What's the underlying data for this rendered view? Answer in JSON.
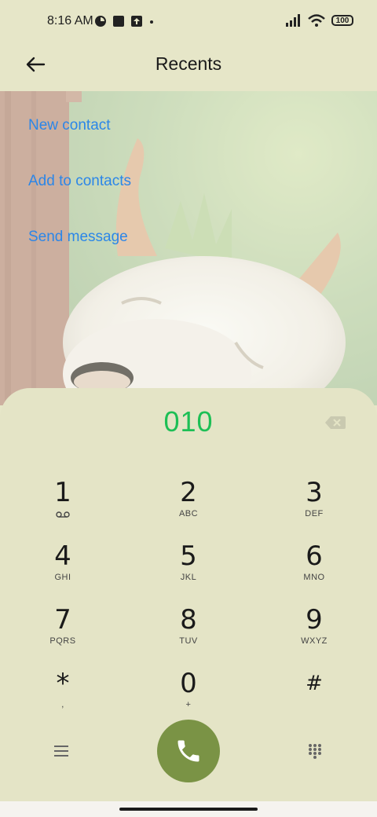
{
  "status_bar": {
    "time": "8:16 AM",
    "battery": "100",
    "icons": [
      "app-notification-icon",
      "square-icon",
      "upload-icon",
      "dot-icon",
      "signal-icon",
      "wifi-icon",
      "battery-icon"
    ]
  },
  "header": {
    "title": "Recents",
    "back_icon": "arrow-left-icon"
  },
  "menu": {
    "items": [
      {
        "label": "New contact"
      },
      {
        "label": "Add to contacts"
      },
      {
        "label": "Send message"
      }
    ]
  },
  "dialer": {
    "number": "010",
    "keys": [
      {
        "digit": "1",
        "letters": ""
      },
      {
        "digit": "2",
        "letters": "ABC"
      },
      {
        "digit": "3",
        "letters": "DEF"
      },
      {
        "digit": "4",
        "letters": "GHI"
      },
      {
        "digit": "5",
        "letters": "JKL"
      },
      {
        "digit": "6",
        "letters": "MNO"
      },
      {
        "digit": "7",
        "letters": "PQRS"
      },
      {
        "digit": "8",
        "letters": "TUV"
      },
      {
        "digit": "9",
        "letters": "WXYZ"
      },
      {
        "digit": "*",
        "letters": ","
      },
      {
        "digit": "0",
        "letters": "+"
      },
      {
        "digit": "#",
        "letters": ""
      }
    ]
  },
  "colors": {
    "background": "#e6e6c8",
    "link": "#2b86e8",
    "number": "#1dbf55",
    "call_button": "#7a9345"
  }
}
